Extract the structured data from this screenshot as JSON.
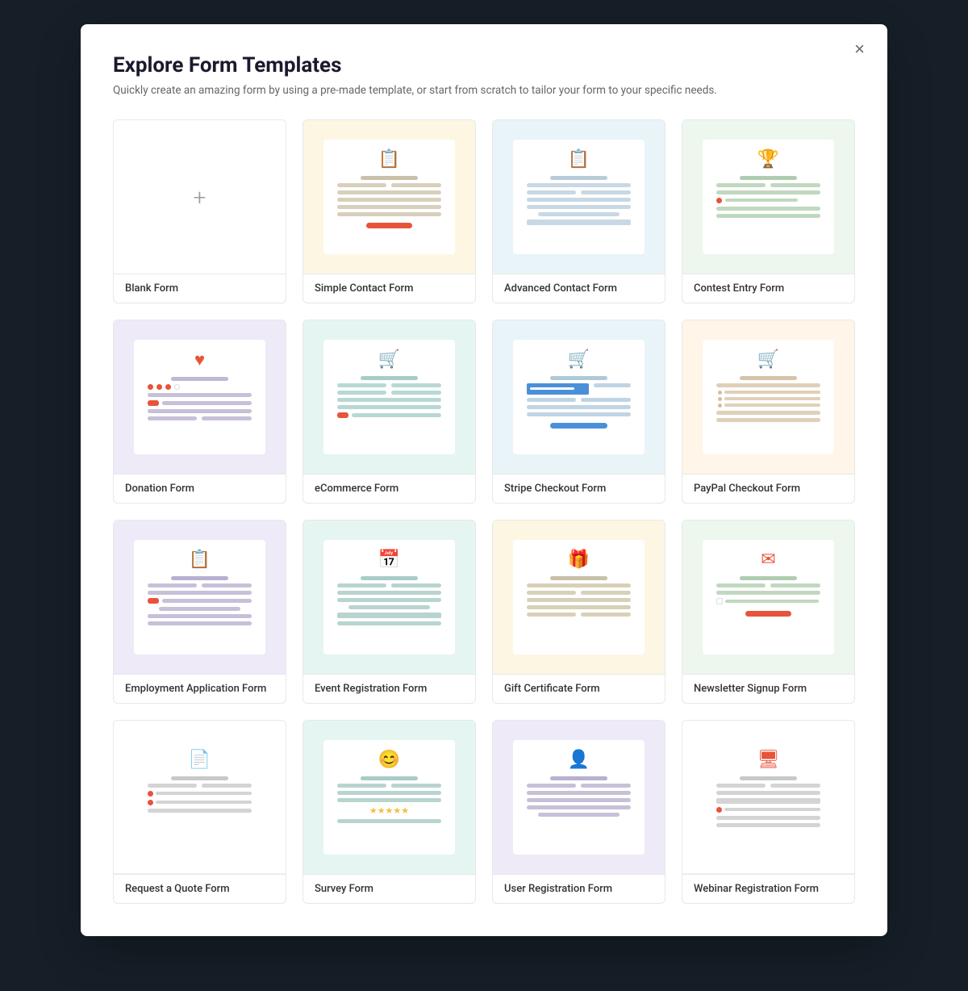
{
  "modal": {
    "title": "Explore Form Templates",
    "subtitle": "Quickly create an amazing form by using a pre-made template, or start from scratch to tailor your form to your specific needs.",
    "close_label": "×"
  },
  "templates": [
    {
      "id": "blank",
      "label": "Blank Form",
      "bg": "bg-white",
      "type": "blank"
    },
    {
      "id": "simple-contact",
      "label": "Simple Contact Form",
      "bg": "bg-yellow",
      "type": "contact-simple"
    },
    {
      "id": "advanced-contact",
      "label": "Advanced Contact Form",
      "bg": "bg-blue-light",
      "type": "contact-advanced"
    },
    {
      "id": "contest-entry",
      "label": "Contest Entry Form",
      "bg": "bg-green-light",
      "type": "contest"
    },
    {
      "id": "donation",
      "label": "Donation Form",
      "bg": "bg-lavender",
      "type": "donation"
    },
    {
      "id": "ecommerce",
      "label": "eCommerce Form",
      "bg": "bg-teal-light",
      "type": "ecommerce"
    },
    {
      "id": "stripe-checkout",
      "label": "Stripe Checkout Form",
      "bg": "bg-blue-light",
      "type": "stripe"
    },
    {
      "id": "paypal-checkout",
      "label": "PayPal Checkout Form",
      "bg": "bg-peach-light",
      "type": "paypal"
    },
    {
      "id": "employment",
      "label": "Employment Application Form",
      "bg": "bg-lavender",
      "type": "employment"
    },
    {
      "id": "event-registration",
      "label": "Event Registration Form",
      "bg": "bg-teal-light",
      "type": "event"
    },
    {
      "id": "gift-certificate",
      "label": "Gift Certificate Form",
      "bg": "bg-yellow",
      "type": "gift"
    },
    {
      "id": "newsletter",
      "label": "Newsletter Signup Form",
      "bg": "bg-green-light",
      "type": "newsletter"
    },
    {
      "id": "request-quote",
      "label": "Request a Quote Form",
      "bg": "bg-white",
      "type": "quote"
    },
    {
      "id": "survey",
      "label": "Survey Form",
      "bg": "bg-teal-light",
      "type": "survey"
    },
    {
      "id": "user-registration",
      "label": "User Registration Form",
      "bg": "bg-lavender",
      "type": "user-reg"
    },
    {
      "id": "webinar",
      "label": "Webinar Registration Form",
      "bg": "bg-white",
      "type": "webinar"
    }
  ],
  "icons": {
    "blank": "+",
    "form": "≡",
    "contact": "📋",
    "cart": "🛒",
    "heart": "❤",
    "trophy": "🏆",
    "calendar": "📅",
    "gift": "🎁",
    "email": "✉",
    "document": "📄",
    "person": "👤",
    "smiley": "😊",
    "screen": "🖥"
  }
}
